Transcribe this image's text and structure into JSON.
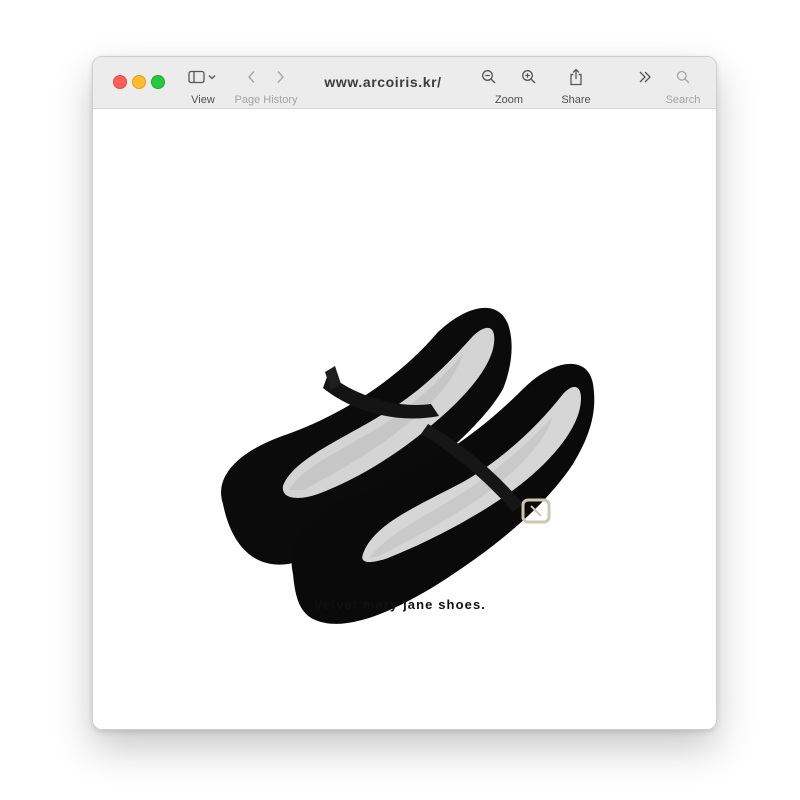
{
  "browser": {
    "url": "www.arcoiris.kr/",
    "toolbar": {
      "view_label": "View",
      "page_history_label": "Page History",
      "zoom_label": "Zoom",
      "share_label": "Share",
      "search_label": "Search"
    },
    "icons": {
      "sidebar": "sidebar-toggle-icon",
      "back": "chevron-left-icon",
      "forward": "chevron-right-icon",
      "zoom_out": "zoom-out-icon",
      "zoom_in": "zoom-in-icon",
      "share": "share-icon",
      "more": "double-chevron-right-icon",
      "search": "search-icon"
    },
    "traffic_lights": {
      "close": "#ff5f57",
      "minimize": "#febc2e",
      "maximize": "#28c840"
    }
  },
  "page": {
    "product_image": "black velvet mary jane shoes",
    "caption": "Velvet mary jane shoes."
  }
}
